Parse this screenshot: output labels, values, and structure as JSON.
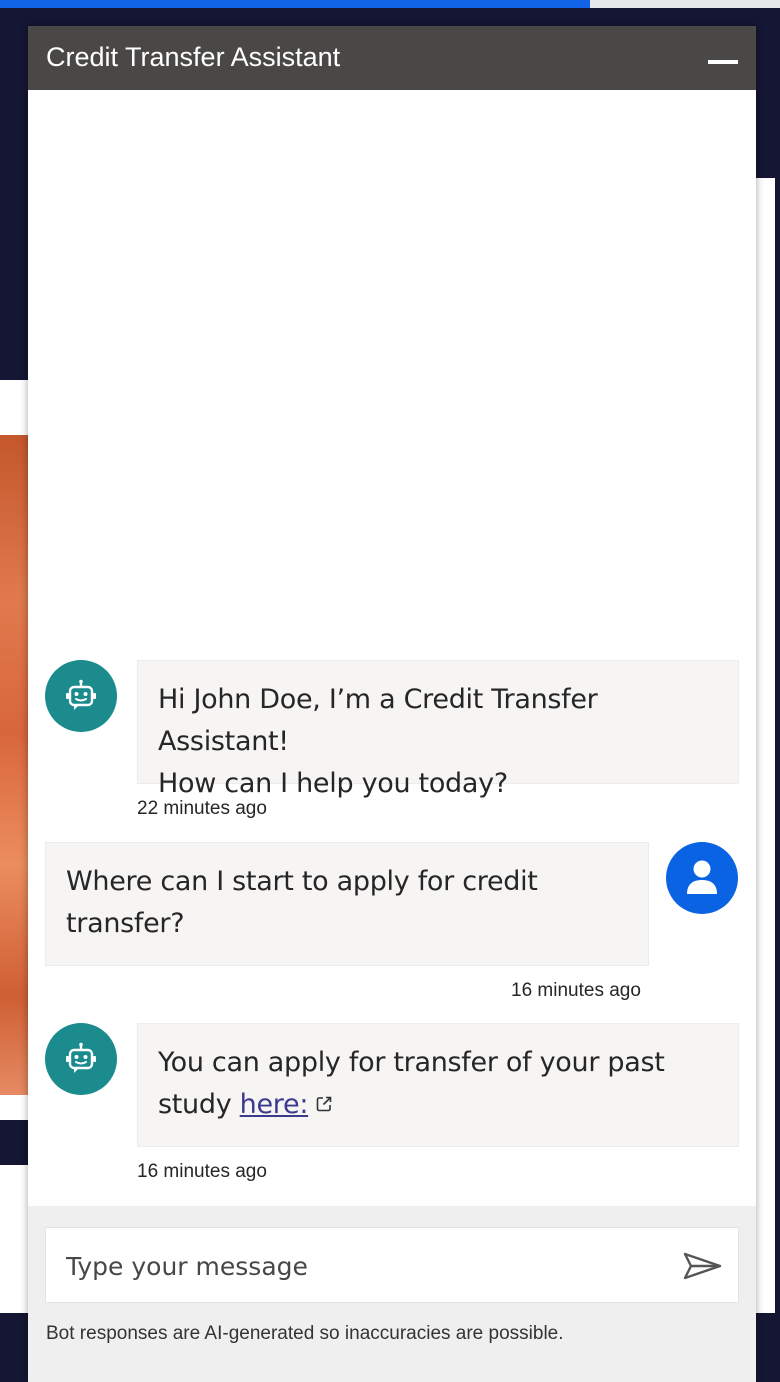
{
  "widget": {
    "title": "Credit Transfer Assistant"
  },
  "messages": [
    {
      "sender": "bot",
      "text_line1": "Hi John Doe, I’m a Credit Transfer Assistant!",
      "text_line2": "How can I help you today?",
      "timestamp": "22 minutes ago"
    },
    {
      "sender": "user",
      "text_line1": "Where can I start to apply for credit",
      "text_line2": "transfer?",
      "timestamp": "16 minutes ago"
    },
    {
      "sender": "bot",
      "text_line1": "You can apply for transfer of your past",
      "text_line2_prefix": "study ",
      "link_text": "here:",
      "timestamp": "16 minutes ago"
    }
  ],
  "composer": {
    "placeholder": "Type your message"
  },
  "disclaimer": "Bot responses are AI-generated so inaccuracies are possible.",
  "colors": {
    "header": "#4a4846",
    "bot_avatar": "#1b8b8e",
    "user_avatar": "#0a63e3",
    "bubble": "#f6f5f4"
  }
}
